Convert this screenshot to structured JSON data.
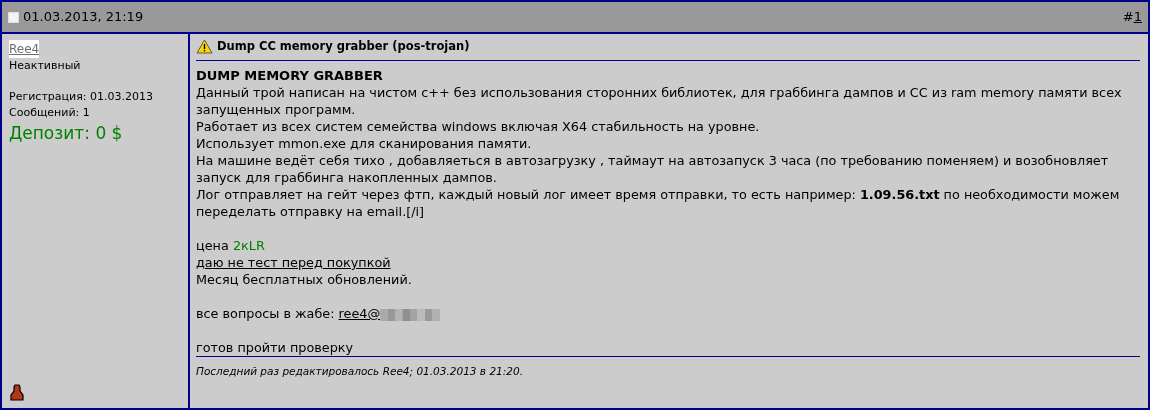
{
  "post_header": {
    "date": "01.03.2013, 21:19",
    "hash": "#",
    "number": "1"
  },
  "author": {
    "name": "Ree4",
    "status": "Неактивный",
    "registration": "Регистрация: 01.03.2013",
    "messages": "Сообщений: 1",
    "deposit": "Депозит: 0 $"
  },
  "post": {
    "title": "Dump CC memory grabber (pos-trojan)",
    "lines": [
      {
        "kind": "heading",
        "text": "DUMP MEMORY GRABBER"
      },
      {
        "kind": "plain",
        "text": "Данный трой написан на чистом с++ без использования сторонних библиотек, для граббинга дампов и СС из ram memory памяти всех запущенных программ."
      },
      {
        "kind": "plain",
        "text": "Работает из всех систем семейства windows включая X64 стабильность на уровне."
      },
      {
        "kind": "plain",
        "text": "Использует mmon.exe для сканирования памяти."
      },
      {
        "kind": "plain",
        "text": "На машине ведёт себя тихо , добавляеться в автозагрузку , таймаут на автозапуск 3 часа (по требованию поменяем) и возобновляет запуск для граббинга накопленных дампов."
      },
      {
        "kind": "plain",
        "text": "Лог отправляет на гейт через фтп, каждый новый лог имеет время отправки, то есть например: **1.09.56.txt** по необходимости можем переделать отправку на email.[/i]"
      },
      {
        "kind": "gap"
      },
      {
        "kind": "price",
        "label": "цена",
        "value": "2кLR",
        "color": "#008000"
      },
      {
        "kind": "link",
        "text": "даю не тест перед покупкой"
      },
      {
        "kind": "plain",
        "text": "Месяц бесплатных обновлений."
      },
      {
        "kind": "gap"
      },
      {
        "kind": "contact",
        "label": "все вопросы в жабе:",
        "link": "ree4@",
        "redacted": true
      },
      {
        "kind": "gap"
      },
      {
        "kind": "plain",
        "text": "готов пройти проверку"
      }
    ],
    "edited": "Последний раз редактировалось Ree4; 01.03.2013 в 21:20."
  }
}
